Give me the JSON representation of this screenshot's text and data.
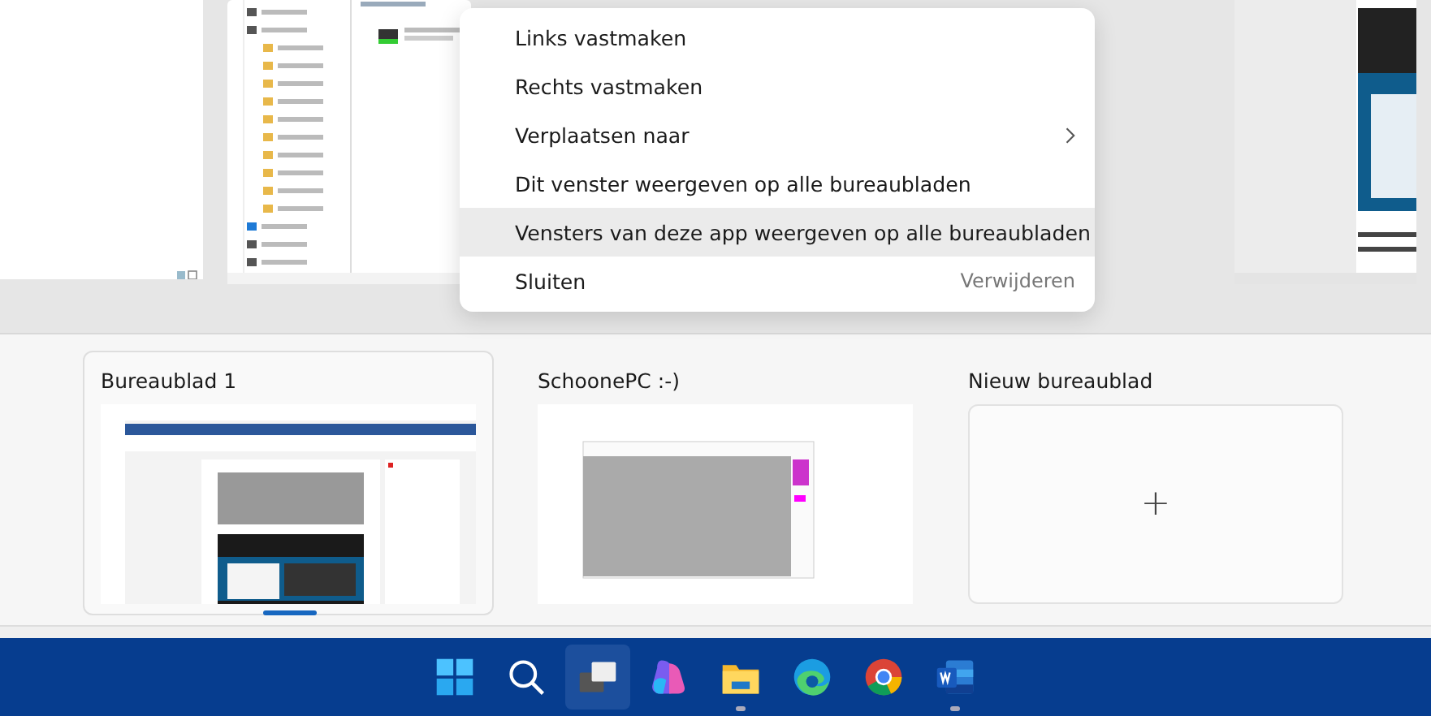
{
  "context_menu": {
    "items": [
      {
        "label": "Links vastmaken",
        "kind": "action",
        "selected": false
      },
      {
        "label": "Rechts vastmaken",
        "kind": "action",
        "selected": false
      },
      {
        "label": "Verplaatsen naar",
        "kind": "submenu",
        "selected": false
      },
      {
        "label": "Dit venster weergeven op alle bureaubladen",
        "kind": "action",
        "selected": false
      },
      {
        "label": "Vensters van deze app weergeven op alle bureaubladen",
        "kind": "action",
        "selected": true
      },
      {
        "label": "Sluiten",
        "kind": "action",
        "selected": false,
        "shortcut": "Verwijderen"
      }
    ]
  },
  "desktops": [
    {
      "title": "Bureaublad 1",
      "selected": true
    },
    {
      "title": "SchoonePC :-)",
      "selected": false
    }
  ],
  "new_desktop": {
    "label": "Nieuw bureaublad",
    "symbol": "+"
  },
  "taskbar": [
    {
      "kind": "start",
      "selected": false,
      "running": false
    },
    {
      "kind": "search",
      "selected": false,
      "running": false
    },
    {
      "kind": "taskview",
      "selected": true,
      "running": false
    },
    {
      "kind": "copilot",
      "selected": false,
      "running": false
    },
    {
      "kind": "explorer",
      "selected": false,
      "running": true
    },
    {
      "kind": "edge",
      "selected": false,
      "running": false
    },
    {
      "kind": "chrome",
      "selected": false,
      "running": false
    },
    {
      "kind": "word",
      "selected": false,
      "running": true
    }
  ]
}
